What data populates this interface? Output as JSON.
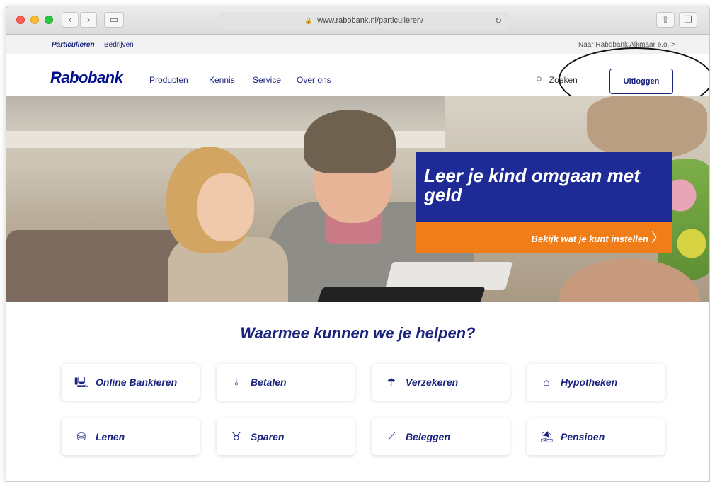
{
  "browser": {
    "url": "www.rabobank.nl/particulieren/"
  },
  "topstrip": {
    "segments": [
      "Particulieren",
      "Bedrijven"
    ],
    "branch": "Naar Rabobank Alkmaar e.o. >"
  },
  "nav": {
    "logo": "Rabobank",
    "links": [
      "Producten",
      "Kennis",
      "Service",
      "Over ons"
    ],
    "search_label": "Zoeken",
    "logout_label": "Uitloggen"
  },
  "promo": {
    "headline": "Leer je kind omgaan met geld",
    "cta": "Bekijk wat je kunt instellen"
  },
  "help": {
    "title": "Waarmee kunnen we je helpen?",
    "tiles": [
      {
        "label": "Online Bankieren",
        "icon": "laptop-icon"
      },
      {
        "label": "Betalen",
        "icon": "wallet-icon"
      },
      {
        "label": "Verzekeren",
        "icon": "umbrella-icon"
      },
      {
        "label": "Hypotheken",
        "icon": "house-icon"
      },
      {
        "label": "Lenen",
        "icon": "coins-icon"
      },
      {
        "label": "Sparen",
        "icon": "piggybank-icon"
      },
      {
        "label": "Beleggen",
        "icon": "chart-icon"
      },
      {
        "label": "Pensioen",
        "icon": "beach-umbrella-icon"
      }
    ]
  },
  "colors": {
    "brand_blue": "#1a237e",
    "promo_blue": "#1e2a96",
    "promo_orange": "#f07d18"
  }
}
